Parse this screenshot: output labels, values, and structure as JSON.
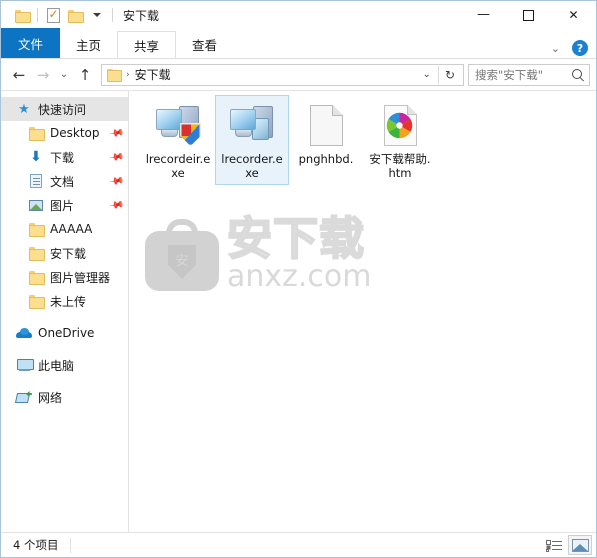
{
  "window": {
    "title": "安下载",
    "quick_access_toolbar": [
      {
        "name": "folder-properties",
        "icon": "folder-icon"
      },
      {
        "name": "new-folder-check",
        "icon": "document-check-icon"
      },
      {
        "name": "customize-qat",
        "icon": "folder-icon"
      }
    ],
    "controls": {
      "minimize": "—",
      "maximize": "□",
      "close": "✕"
    }
  },
  "ribbon": {
    "tabs": [
      {
        "label": "文件",
        "state": "file-menu"
      },
      {
        "label": "主页",
        "state": "normal"
      },
      {
        "label": "共享",
        "state": "hover"
      },
      {
        "label": "查看",
        "state": "normal"
      }
    ],
    "collapse_chevron": "⌄",
    "help_label": "?"
  },
  "addressbar": {
    "back": "←",
    "forward": "→",
    "recent": "⌄",
    "up": "↑",
    "crumb_icon": "folder-icon",
    "crumb_separator": "›",
    "crumb": "安下载",
    "dropdown": "⌄",
    "refresh": "↻"
  },
  "search": {
    "value": "",
    "placeholder": "搜索\"安下载\"",
    "icon": "search-icon"
  },
  "sidebar": {
    "items": [
      {
        "label": "快速访问",
        "icon": "star-icon",
        "indent": 0,
        "selected": true,
        "pinned": false
      },
      {
        "label": "Desktop",
        "icon": "folder-icon",
        "indent": 1,
        "selected": false,
        "pinned": true
      },
      {
        "label": "下载",
        "icon": "download-icon",
        "indent": 1,
        "selected": false,
        "pinned": true
      },
      {
        "label": "文档",
        "icon": "document-icon",
        "indent": 1,
        "selected": false,
        "pinned": true
      },
      {
        "label": "图片",
        "icon": "pictures-icon",
        "indent": 1,
        "selected": false,
        "pinned": true
      },
      {
        "label": "AAAAA",
        "icon": "folder-icon",
        "indent": 1,
        "selected": false,
        "pinned": false
      },
      {
        "label": "安下载",
        "icon": "folder-icon",
        "indent": 1,
        "selected": false,
        "pinned": false
      },
      {
        "label": "图片管理器",
        "icon": "folder-icon",
        "indent": 1,
        "selected": false,
        "pinned": false
      },
      {
        "label": "未上传",
        "icon": "folder-icon",
        "indent": 1,
        "selected": false,
        "pinned": false
      },
      {
        "label": "OneDrive",
        "icon": "cloud-icon",
        "indent": 0,
        "selected": false,
        "pinned": false
      },
      {
        "label": "此电脑",
        "icon": "this-pc-icon",
        "indent": 0,
        "selected": false,
        "pinned": false
      },
      {
        "label": "网络",
        "icon": "network-icon",
        "indent": 0,
        "selected": false,
        "pinned": false
      }
    ],
    "pin_glyph": "📌"
  },
  "files": [
    {
      "name": "lrecordeir.exe",
      "icon": "exe-shield-icon",
      "selected": false
    },
    {
      "name": "lrecorder.exe",
      "icon": "exe-icon",
      "selected": true
    },
    {
      "name": "pnghhbd.",
      "icon": "blank-document-icon",
      "selected": false
    },
    {
      "name": "安下载帮助.htm",
      "icon": "html-pinwheel-icon",
      "selected": false
    }
  ],
  "watermark": {
    "logo_char": "安",
    "text_cn": "安下载",
    "text_en": "anxz.com"
  },
  "statusbar": {
    "item_count": "4 个项目",
    "views": [
      {
        "name": "details-view",
        "active": false
      },
      {
        "name": "large-icons-view",
        "active": true
      }
    ]
  }
}
